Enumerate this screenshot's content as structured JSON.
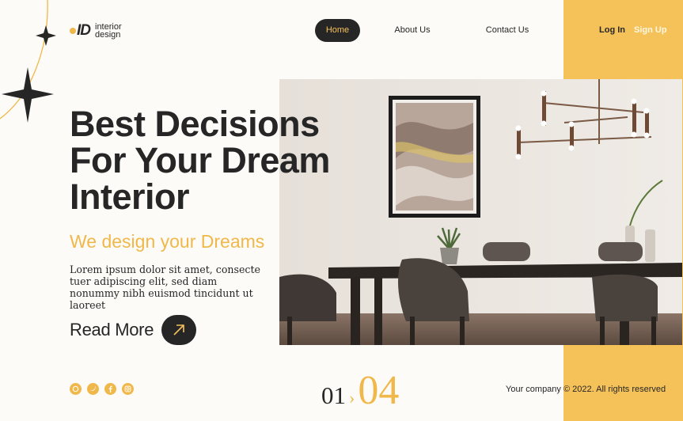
{
  "brand": {
    "mark": "ID",
    "line1": "interior",
    "line2": "design"
  },
  "nav": {
    "home": "Home",
    "about": "About Us",
    "contact": "Contact Us"
  },
  "auth": {
    "login": "Log In",
    "signup": "Sign Up"
  },
  "hero": {
    "headline": [
      "Best Decisions",
      "For Your Dream",
      "Interior"
    ],
    "subheadline": "We design your Dreams",
    "body": "Lorem ipsum dolor sit amet, consecte tuer adipiscing elit, sed diam nonummy nibh euismod tincidunt ut laoreet",
    "cta": "Read More"
  },
  "social": [
    "whatsapp-icon",
    "twitter-icon",
    "facebook-icon",
    "instagram-icon"
  ],
  "pager": {
    "current": "01",
    "total": "04"
  },
  "footer": {
    "copyright": "Your company © 2022. All rights reserved"
  },
  "colors": {
    "accent": "#f5c25a",
    "dark": "#262626",
    "background": "#fdfbf8"
  }
}
